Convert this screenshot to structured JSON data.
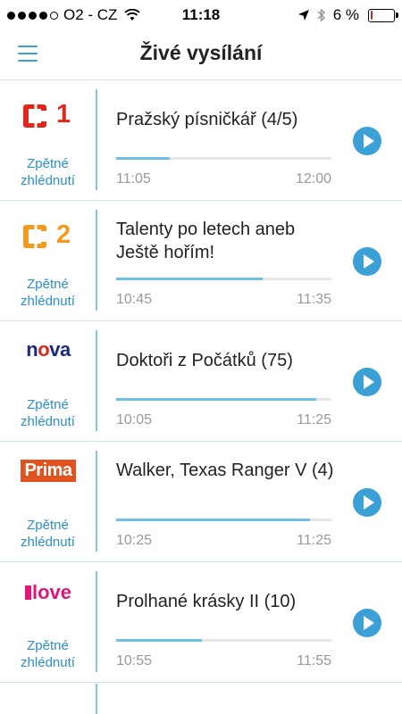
{
  "status_bar": {
    "carrier": "O2 - CZ",
    "time": "11:18",
    "battery": "6 %",
    "battery_level": 0.06
  },
  "nav": {
    "title": "Živé vysílání"
  },
  "replay_label_line1": "Zpětné",
  "replay_label_line2": "zhlédnutí",
  "colors": {
    "accent": "#3aa0d5",
    "progress": "#6fc0e6",
    "divider": "#cfe6ef"
  },
  "rows": [
    {
      "channel_icon": "ct1-logo",
      "logo_text": "1",
      "title": "Pražský písničkář (4/5)",
      "start": "11:05",
      "end": "12:00",
      "progress": 0.25
    },
    {
      "channel_icon": "ct2-logo",
      "logo_text": "2",
      "title": "Talenty po letech aneb Ještě hořím!",
      "start": "10:45",
      "end": "11:35",
      "progress": 0.68
    },
    {
      "channel_icon": "nova-logo",
      "logo_text": "nova",
      "title": "Doktoři z Počátků (75)",
      "start": "10:05",
      "end": "11:25",
      "progress": 0.93
    },
    {
      "channel_icon": "prima-logo",
      "logo_text": "Prima",
      "title": "Walker, Texas Ranger V (4)",
      "start": "10:25",
      "end": "11:25",
      "progress": 0.9
    },
    {
      "channel_icon": "love-logo",
      "logo_text": "love",
      "title": "Prolhané krásky II (10)",
      "start": "10:55",
      "end": "11:55",
      "progress": 0.4
    }
  ]
}
